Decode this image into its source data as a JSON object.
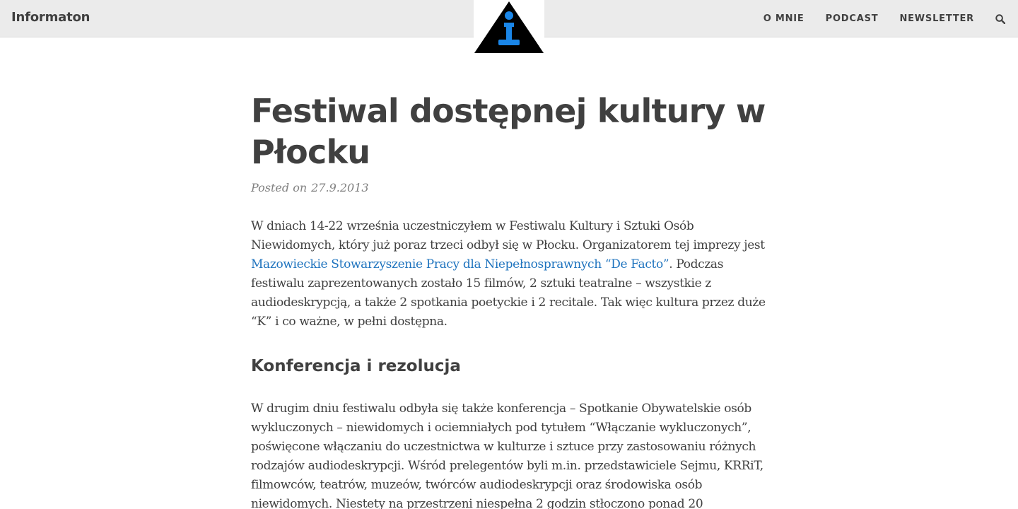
{
  "site": {
    "title": "Informaton"
  },
  "logo": {
    "name": "info-triangle-logo",
    "triangle_color": "#000000",
    "glyph_color": "#1a86e8"
  },
  "nav": {
    "items": [
      {
        "label": "O MNIE"
      },
      {
        "label": "PODCAST"
      },
      {
        "label": "NEWSLETTER"
      }
    ],
    "search_icon": "search-icon"
  },
  "post": {
    "title": "Festiwal dostępnej kultury w Płocku",
    "meta_label": "Posted on",
    "date": "27.9.2013",
    "paragraph1": {
      "before_link": "W dniach 14-22 września uczestniczyłem w Festiwalu Kultury i Sztuki Osób Niewidomych, który już poraz trzeci odbył się w Płocku. Organizatorem tej imprezy jest ",
      "link_text": "Mazowieckie Stowarzyszenie Pracy dla Niepełnosprawnych “De Facto”",
      "after_link": ". Podczas festiwalu zaprezentowanych zostało 15 filmów, 2 sztuki teatralne – wszystkie z audiodeskrypcją, a także 2 spotkania poetyckie i 2 recitale. Tak więc kultura przez duże “K” i co ważne, w pełni dostępna."
    },
    "section_heading": "Konferencja i rezolucja",
    "paragraph2": "W drugim dniu festiwalu odbyła się także konferencja – Spotkanie Obywatelskie osób wykluczonych – niewidomych i ociemniałych pod tytułem “Włączanie wykluczonych”, poświęcone włączaniu do uczestnictwa w kulturze i sztuce przy zastosowaniu różnych rodzajów audiodeskrypcji. Wśród prelegentów byli m.in. przedstawiciele Sejmu, KRRiT, filmowców, teatrów, muzeów, twórców audiodeskrypcji oraz środowiska osób niewidomych. Niestety na przestrzeni niespełna 2 godzin stłoczono ponad 20"
  },
  "colors": {
    "topbar_bg": "#ebebeb",
    "text": "#404040",
    "meta": "#808080",
    "link": "#1e73be"
  }
}
